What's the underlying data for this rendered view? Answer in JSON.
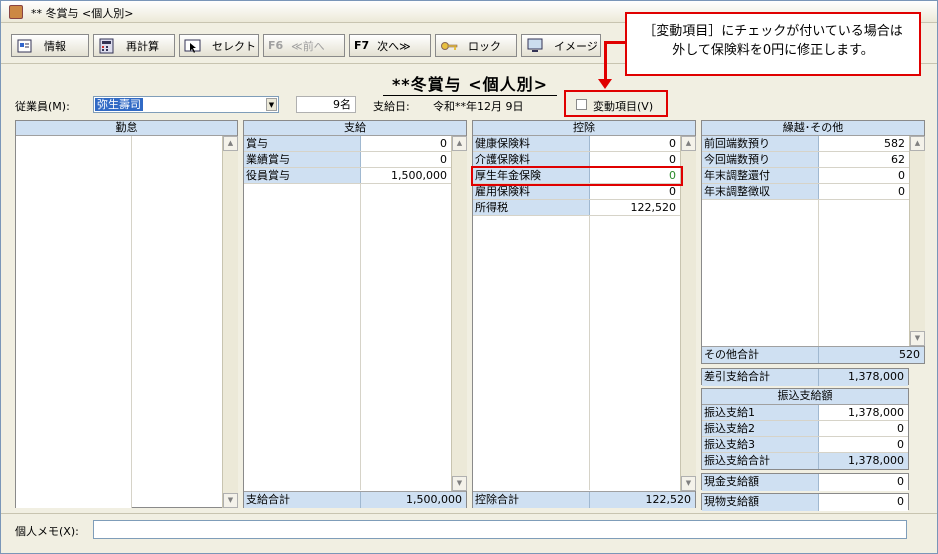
{
  "window": {
    "title": "** 冬賞与 <個人別>"
  },
  "toolbar": {
    "info": "情報",
    "recalc": "再計算",
    "select": "セレクト",
    "prev_key": "F6",
    "prev": "≪前へ",
    "next_key": "F7",
    "next": "次へ≫",
    "lock": "ロック",
    "image": "イメージ"
  },
  "page_title": "**冬賞与 <個人別>",
  "employee": {
    "label": "従業員(M):",
    "value": "弥生壽司",
    "count": "9名"
  },
  "payment": {
    "label": "支給日:",
    "date": "令和**年12月 9日"
  },
  "variable_item": {
    "label": "変動項目(V)",
    "checked": false
  },
  "callout": {
    "line1": "［変動項目］にチェックが付いている場合は",
    "line2": "外して保険料を0円に修正します。"
  },
  "attendance": {
    "header": "勤怠"
  },
  "payments": {
    "header": "支給",
    "rows": [
      {
        "label": "賞与",
        "value": "0"
      },
      {
        "label": "業績賞与",
        "value": "0"
      },
      {
        "label": "役員賞与",
        "value": "1,500,000"
      }
    ],
    "total_label": "支給合計",
    "total_value": "1,500,000"
  },
  "deductions": {
    "header": "控除",
    "rows": [
      {
        "label": "健康保険料",
        "value": "0"
      },
      {
        "label": "介護保険料",
        "value": "0"
      },
      {
        "label": "厚生年金保険",
        "value": "0"
      },
      {
        "label": "雇用保険料",
        "value": "0"
      },
      {
        "label": "所得税",
        "value": "122,520"
      }
    ],
    "total_label": "控除合計",
    "total_value": "122,520"
  },
  "carryover": {
    "header": "繰越･その他",
    "rows": [
      {
        "label": "前回端数預り",
        "value": "582"
      },
      {
        "label": "今回端数預り",
        "value": "62"
      },
      {
        "label": "年末調整還付",
        "value": "0"
      },
      {
        "label": "年末調整徴収",
        "value": "0"
      }
    ],
    "other_total_label": "その他合計",
    "other_total_value": "520",
    "net_label": "差引支給合計",
    "net_value": "1,378,000"
  },
  "transfer": {
    "header": "振込支給額",
    "rows": [
      {
        "label": "振込支給1",
        "value": "1,378,000"
      },
      {
        "label": "振込支給2",
        "value": "0"
      },
      {
        "label": "振込支給3",
        "value": "0"
      },
      {
        "label": "振込支給合計",
        "value": "1,378,000"
      }
    ]
  },
  "cash": {
    "label": "現金支給額",
    "value": "0"
  },
  "goods": {
    "label": "現物支給額",
    "value": "0"
  },
  "memo": {
    "label": "個人メモ(X):",
    "value": ""
  }
}
